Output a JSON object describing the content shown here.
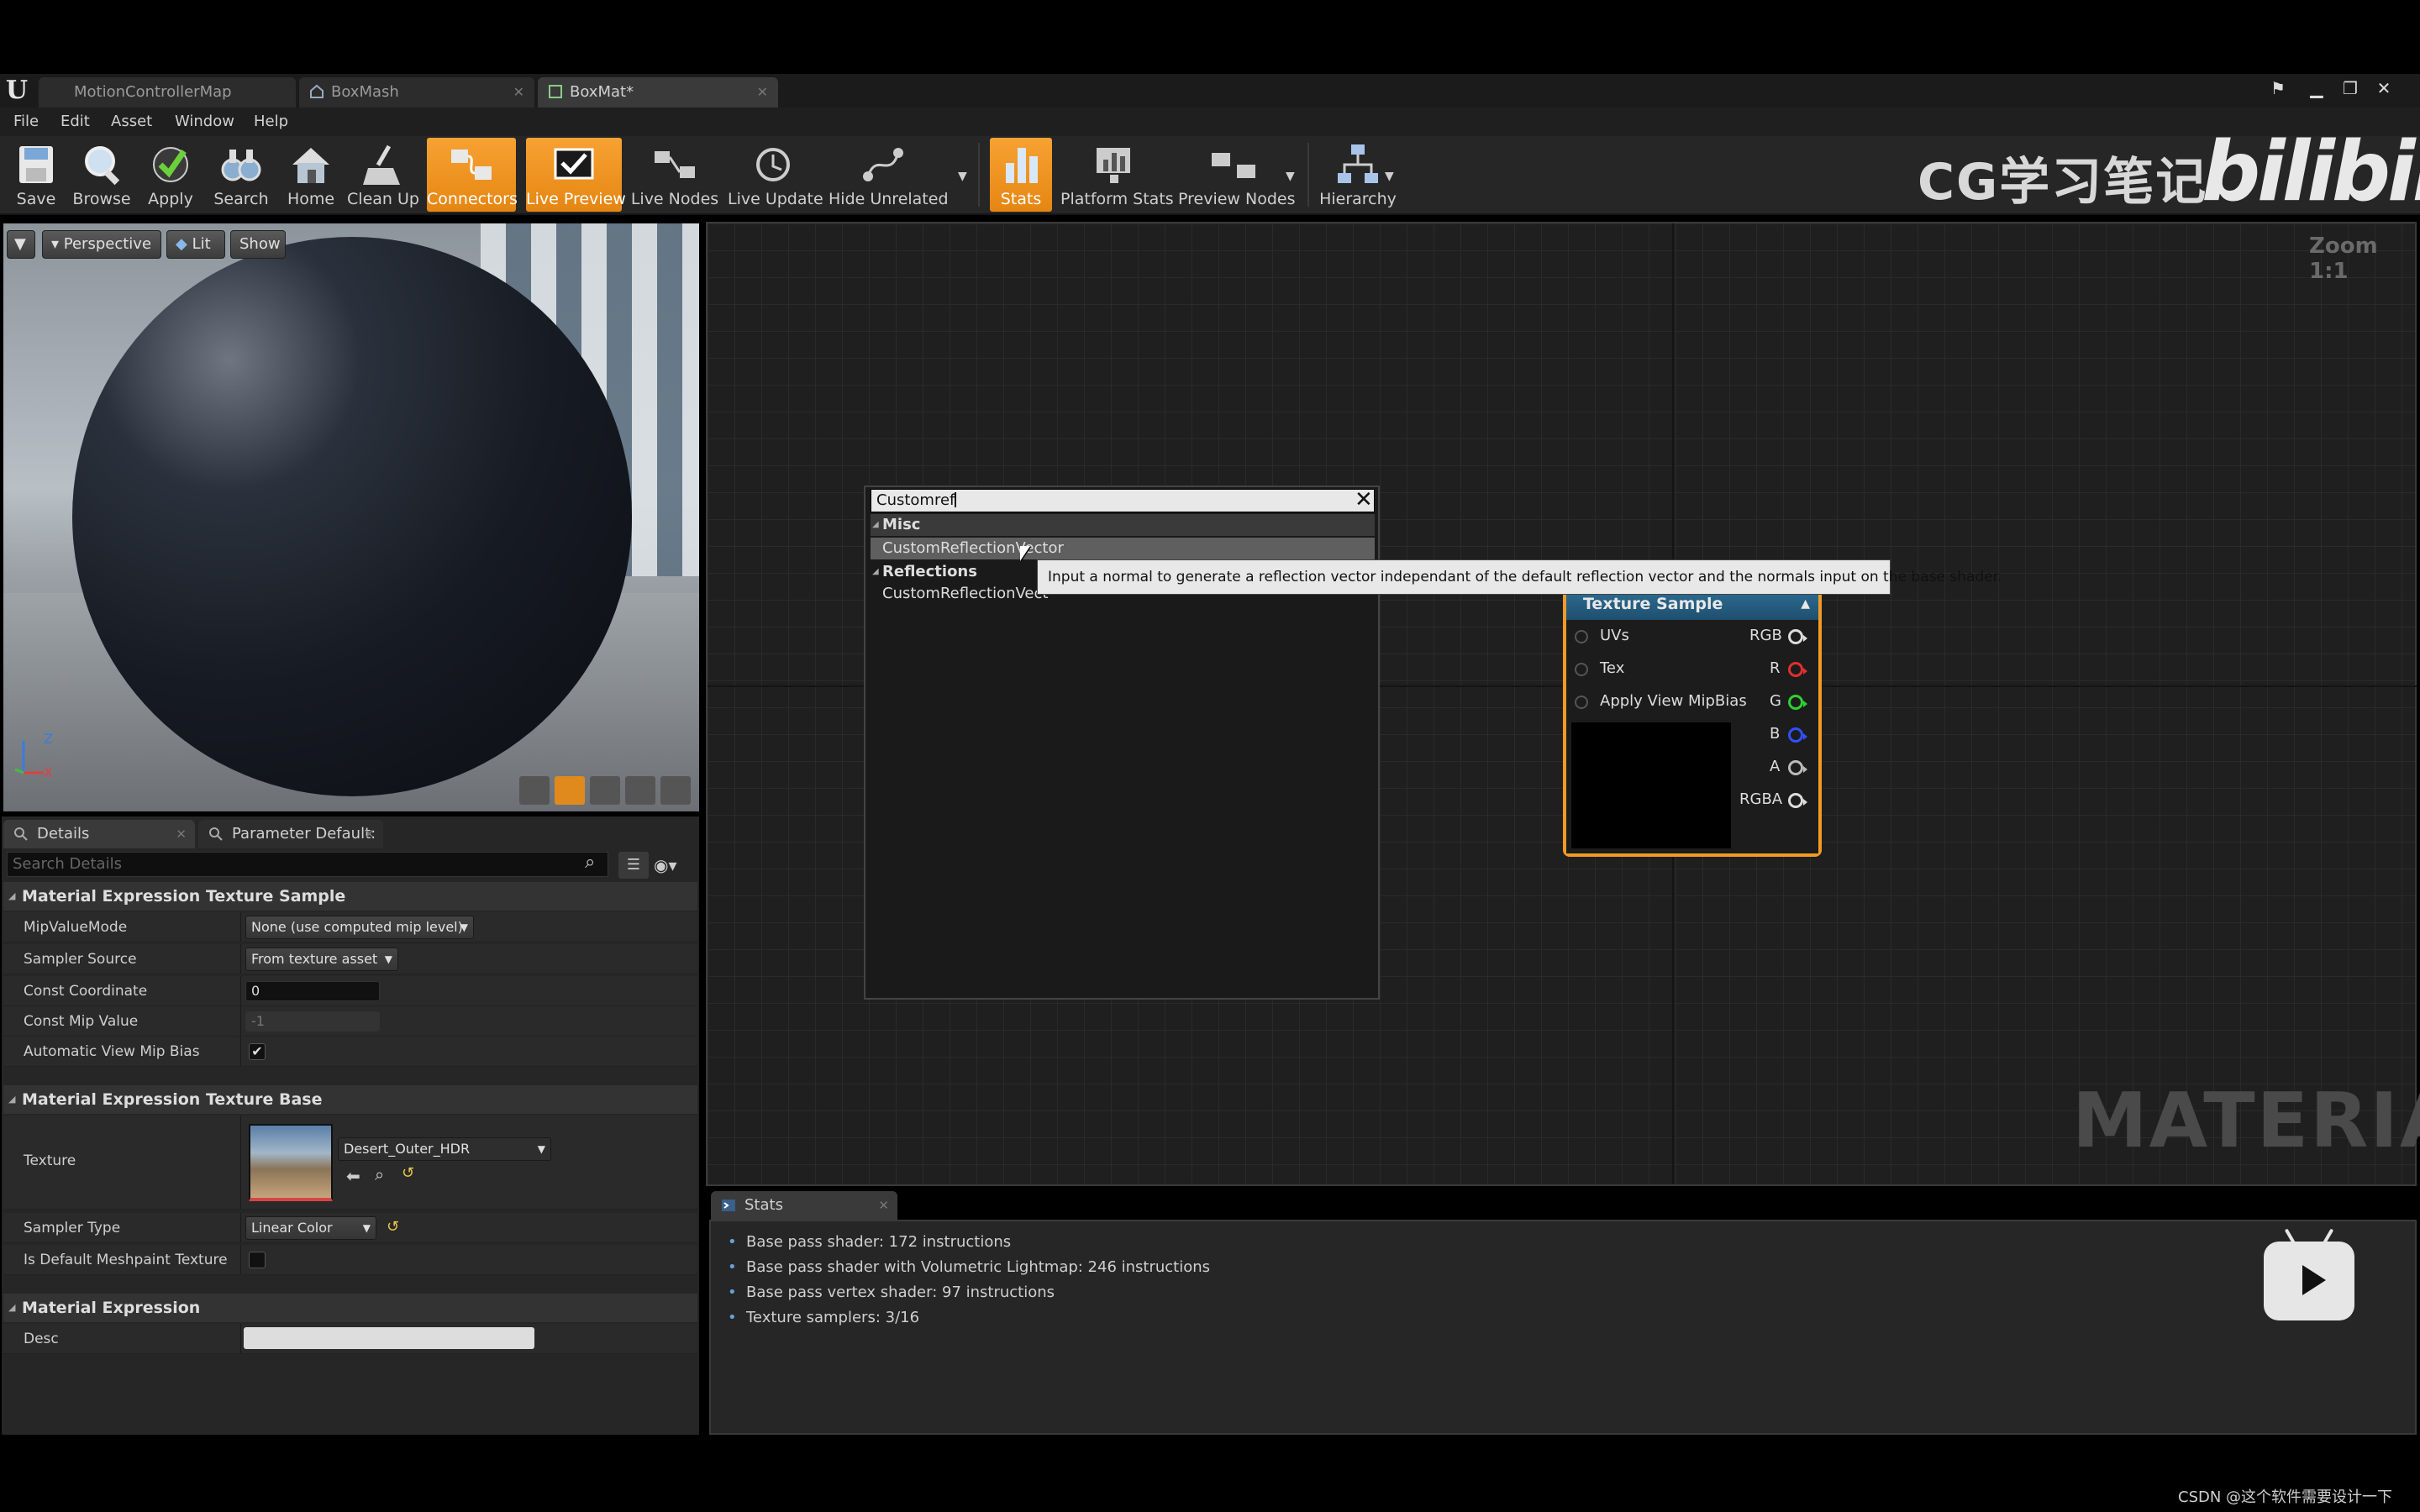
{
  "tabs": [
    {
      "label": "MotionControllerMap"
    },
    {
      "label": "BoxMash"
    },
    {
      "label": "BoxMat*"
    }
  ],
  "menu": [
    "File",
    "Edit",
    "Asset",
    "Window",
    "Help"
  ],
  "toolbar": {
    "buttons": [
      {
        "label": "Save"
      },
      {
        "label": "Browse"
      },
      {
        "label": "Apply"
      },
      {
        "label": "Search"
      },
      {
        "label": "Home"
      },
      {
        "label": "Clean Up"
      },
      {
        "label": "Connectors"
      },
      {
        "label": "Live Preview"
      },
      {
        "label": "Live Nodes"
      },
      {
        "label": "Live Update"
      },
      {
        "label": "Hide Unrelated"
      },
      {
        "label": "Stats"
      },
      {
        "label": "Platform Stats"
      },
      {
        "label": "Preview Nodes"
      },
      {
        "label": "Hierarchy"
      }
    ]
  },
  "watermark": {
    "text": "CG学习笔记",
    "brand": "bilibili"
  },
  "viewport": {
    "perspective": "Perspective",
    "lit": "Lit",
    "show": "Show",
    "axis_z": "Z",
    "axis_x": "X"
  },
  "details": {
    "tabs": [
      {
        "label": "Details"
      },
      {
        "label": "Parameter Default:"
      }
    ],
    "search_placeholder": "Search Details",
    "sections": [
      {
        "title": "Material Expression Texture Sample"
      },
      {
        "title": "Material Expression Texture Base"
      },
      {
        "title": "Material Expression"
      }
    ],
    "props": {
      "mip_value_mode": {
        "label": "MipValueMode",
        "value": "None (use computed mip level)"
      },
      "sampler_source": {
        "label": "Sampler Source",
        "value": "From texture asset"
      },
      "const_coordinate": {
        "label": "Const Coordinate",
        "value": "0"
      },
      "const_mip_value": {
        "label": "Const Mip Value",
        "value": "-1"
      },
      "automatic_view_mip_bias": {
        "label": "Automatic View Mip Bias",
        "checked": "✔"
      },
      "texture": {
        "label": "Texture",
        "value": "Desert_Outer_HDR"
      },
      "sampler_type": {
        "label": "Sampler Type",
        "value": "Linear Color"
      },
      "is_default_meshpaint": {
        "label": "Is Default Meshpaint Texture"
      },
      "desc": {
        "label": "Desc"
      }
    }
  },
  "graph": {
    "zoom": "Zoom 1:1",
    "watermark": "MATERIAL",
    "node": {
      "title": "Texture Sample",
      "inputs": [
        "UVs",
        "Tex",
        "Apply View MipBias"
      ],
      "outputs": [
        {
          "label": "RGB",
          "color": "#dddddd"
        },
        {
          "label": "R",
          "color": "#e03030"
        },
        {
          "label": "G",
          "color": "#30d030"
        },
        {
          "label": "B",
          "color": "#3050ff"
        },
        {
          "label": "A",
          "color": "#bbbbbb"
        },
        {
          "label": "RGBA",
          "color": "#dddddd"
        }
      ]
    },
    "context_menu": {
      "search_value": "Customref",
      "categories": [
        {
          "name": "Misc",
          "items": [
            "CustomReflectionVector"
          ]
        },
        {
          "name": "Reflections",
          "items": [
            "CustomReflectionVect"
          ]
        }
      ],
      "tooltip": "Input a normal to generate a reflection vector independant of the default reflection vector and the normals input on the base shader."
    }
  },
  "stats": {
    "tab": "Stats",
    "lines": [
      "Base pass shader: 172 instructions",
      "Base pass shader with Volumetric Lightmap: 246 instructions",
      "Base pass vertex shader: 97 instructions",
      "Texture samplers: 3/16"
    ]
  },
  "credit": "CSDN @这个软件需要设计一下",
  "colors": {
    "accent": "#f29a23",
    "node_header": "#2e6f96"
  }
}
